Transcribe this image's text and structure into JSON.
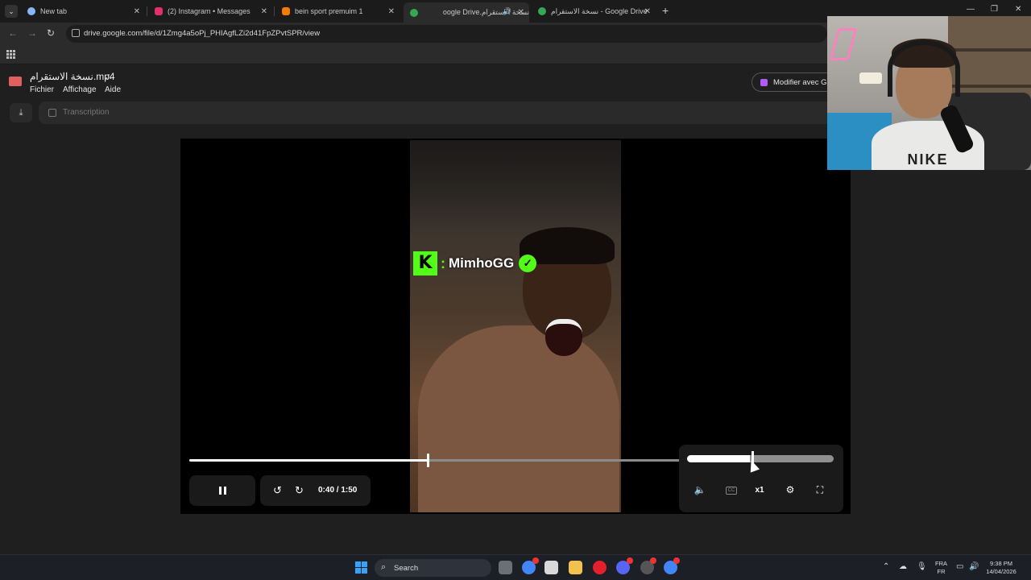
{
  "browser": {
    "tabs": [
      {
        "label": "New tab",
        "favicon_color": "#8ab4f8",
        "active": false
      },
      {
        "label": "(2) Instagram • Messages",
        "favicon_color": "#e1306c",
        "active": false
      },
      {
        "label": "bein sport premuim 1",
        "favicon_color": "#f57c00",
        "active": false
      },
      {
        "label": "نسخة الاستقرام.oogle Drive",
        "favicon_color": "#34a853",
        "active": true
      },
      {
        "label": "نسخة الاستقرام - Google Drive",
        "favicon_color": "#34a853",
        "active": false
      }
    ],
    "new_tab_glyph": "+",
    "url": "drive.google.com/file/d/1Zmg4a5oPj_PHIAgfLZi2d41FpZPvtSPR/view"
  },
  "drive": {
    "file_title": "نسخة الاستقرام.mp4",
    "menu": [
      "Fichier",
      "Affichage",
      "Aide"
    ],
    "modify_button": "Modifier avec G",
    "transcript_label": "Transcription"
  },
  "video": {
    "overlay": {
      "kick_letter": "K",
      "colon": ":",
      "streamer_name": "MimhoGG",
      "verified_glyph": "✓"
    },
    "current_time": "0:40",
    "duration": "1:50",
    "time_display": "0:40 / 1:50",
    "progress_fraction": 0.486,
    "volume_fraction": 0.43,
    "speed_label": "x1",
    "cc_label": "CC"
  },
  "webcam": {
    "shirt_text": "NIKE"
  },
  "taskbar": {
    "search_label": "Search",
    "language": "FRA",
    "language_sub": "FR",
    "time": "9:38 PM",
    "date": "14/04/2026"
  },
  "colors": {
    "kick_green": "#53fc18",
    "windows_blue": "#3aa0ff"
  }
}
